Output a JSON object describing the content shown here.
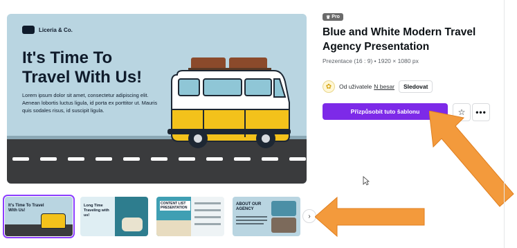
{
  "preview": {
    "brand": "Liceria & Co.",
    "headline_line1": "It's Time To",
    "headline_line2": "Travel With Us!",
    "body": "Lorem ipsum dolor sit amet, consectetur adipiscing elit. Aenean lobortis luctus ligula, id porta ex porttitor ut. Mauris quis sodales risus, id suscipit ligula."
  },
  "template": {
    "badge": "Pro",
    "title": "Blue and White Modern Travel Agency Presentation",
    "meta": "Prezentace (16 : 9) • 1920 × 1080 px",
    "author_prefix": "Od uživatele",
    "author_name": "N besar",
    "follow_label": "Sledovat",
    "cta_label": "Přizpůsobit tuto šablonu"
  },
  "thumbnails": [
    {
      "title": "It's Time To Travel With Us!"
    },
    {
      "title": "Long Time Traveling with us!"
    },
    {
      "title": "CONTENT LIST PRESENTATION"
    },
    {
      "title": "ABOUT OUR AGENCY"
    }
  ],
  "icons": {
    "favorite": "star-icon",
    "more": "more-icon",
    "next": "chevron-right-icon"
  },
  "colors": {
    "accent": "#7d2ae8",
    "annotation_arrow": "#f39a3c",
    "preview_bg": "#b9d5e1"
  }
}
